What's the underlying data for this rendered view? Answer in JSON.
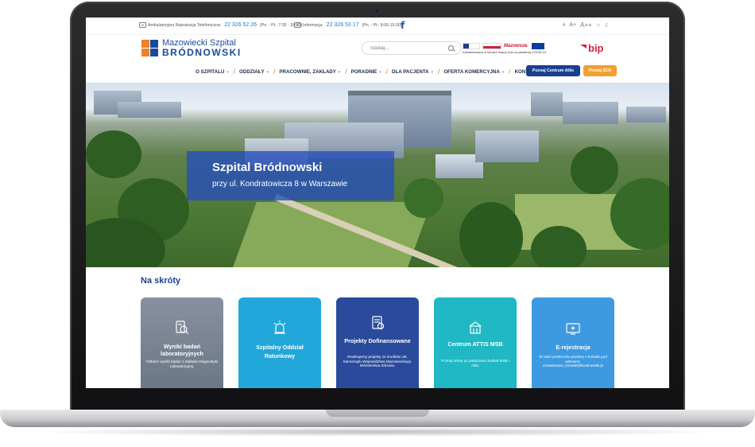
{
  "topbar": {
    "phone1_label": "Ambulatoryjna Rejestracja Telefoniczna:",
    "phone1_number": "22 326 52 26",
    "phone1_hours": "(Pn. - Pt.: 7:30 - 18:00)",
    "phone2_label": "Informacja:",
    "phone2_number": "22 326 53 17",
    "phone2_hours": "(Pn. - Pt.: 8:00-15:30)",
    "facebook_icon": "facebook-icon",
    "font_small": "A",
    "font_medium": "A+",
    "font_large": "A++",
    "theme_light_icon": "☼",
    "theme_dark_icon": "☾"
  },
  "header": {
    "logo_line1": "Mazowiecki Szpital",
    "logo_line2": "BRÓDNOWSKI",
    "search_placeholder": "Szukaj...",
    "funding_mazowsze": "Mazowsze.",
    "funding_caption": "Dofinansowano w ramach reakcji Unii na pandemię COVID-19",
    "bip": "bip"
  },
  "nav": {
    "items": [
      {
        "label": "O SZPITALU"
      },
      {
        "label": "ODDZIAŁY"
      },
      {
        "label": "PRACOWNIE, ZAKŁADY"
      },
      {
        "label": "PORADNIE"
      },
      {
        "label": "DLA PACJENTA"
      },
      {
        "label": "OFERTA KOMERCYJNA"
      },
      {
        "label": "KONTAKT"
      }
    ],
    "btn_centrum": "Poznaj Centrum Attis",
    "btn_sck": "Poznaj ŚCK"
  },
  "hero": {
    "title": "Szpital Bródnowski",
    "subtitle": "przy ul. Kondratowicza 8 w Warszawie"
  },
  "shortcuts": {
    "title": "Na skróty",
    "tiles": [
      {
        "title": "Wyniki badań laboratoryjnych",
        "desc": "Odbierz wyniki badań z Zakładu Diagnostyki Laboratoryjnej.",
        "icon": "lab-results-icon",
        "color": "#7d8796"
      },
      {
        "title": "Szpitalny Oddział Ratunkowy",
        "desc": "",
        "icon": "emergency-light-icon",
        "color": "#21a7da"
      },
      {
        "title": "Projekty Dofinansowane",
        "desc": "Realizujemy projekty ze środków UE, Samorządu Województwa Mazowieckiego, Ministerstwa Zdrowia.",
        "icon": "funded-projects-icon",
        "color": "#2a4a9c"
      },
      {
        "title": "Centrum ATTIS MSB",
        "desc": "Poznaj ofertę po połączeniu Spółek MSB i Attis.",
        "icon": "building-icon",
        "color": "#1fb8c4"
      },
      {
        "title": "E-rejestracja",
        "desc": "W razie problemów prosimy o kontakt pod adresem: ezwasteraze_kontakt@brodnowski.js",
        "icon": "e-registration-icon",
        "color": "#3d9ae0"
      }
    ]
  }
}
